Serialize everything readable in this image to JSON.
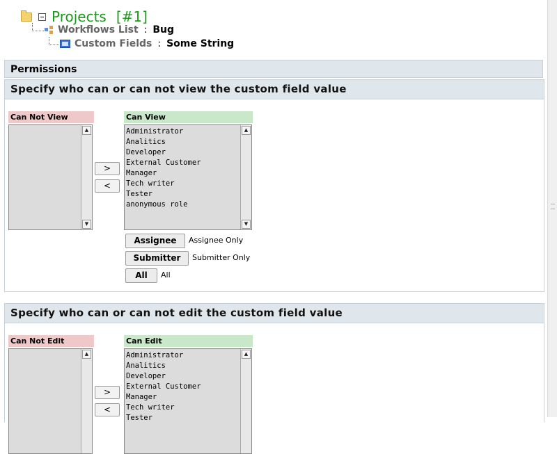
{
  "breadcrumb": {
    "project_title": "Projects",
    "project_id": "[#1]",
    "workflow_label": "Workflows List",
    "workflow_value": "Bug",
    "custom_field_label": "Custom Fields",
    "custom_field_value": "Some String",
    "colon": ":"
  },
  "permissions": {
    "header": "Permissions"
  },
  "view_section": {
    "title": "Specify who can or can not view the custom field value",
    "not_label": "Can Not View",
    "can_label": "Can View",
    "can_items": [
      "Administrator",
      "Analitics",
      "Developer",
      "External Customer",
      "Manager",
      "Tech writer",
      "Tester",
      "anonymous role"
    ],
    "move_right": ">",
    "move_left": "<",
    "role_buttons": [
      {
        "label": "Assignee",
        "desc": "Assignee Only"
      },
      {
        "label": "Submitter",
        "desc": "Submitter Only"
      },
      {
        "label": "All",
        "desc": "All"
      }
    ]
  },
  "edit_section": {
    "title": "Specify who can or can not edit the custom field value",
    "not_label": "Can Not Edit",
    "can_label": "Can Edit",
    "can_items": [
      "Administrator",
      "Analitics",
      "Developer",
      "External Customer",
      "Manager",
      "Tech writer",
      "Tester"
    ],
    "move_right": ">",
    "move_left": "<"
  },
  "icons": {
    "folder": "folder-icon",
    "collapse": "collapse-icon",
    "workflow": "workflow-icon",
    "custom_field": "custom-field-icon",
    "scroll_up": "▲",
    "scroll_down": "▼"
  },
  "colors": {
    "project_title": "#1a9a1a",
    "header_bg": "#dfe6ec",
    "deny_label_bg": "#efc9c9",
    "allow_label_bg": "#c9e8c9"
  }
}
